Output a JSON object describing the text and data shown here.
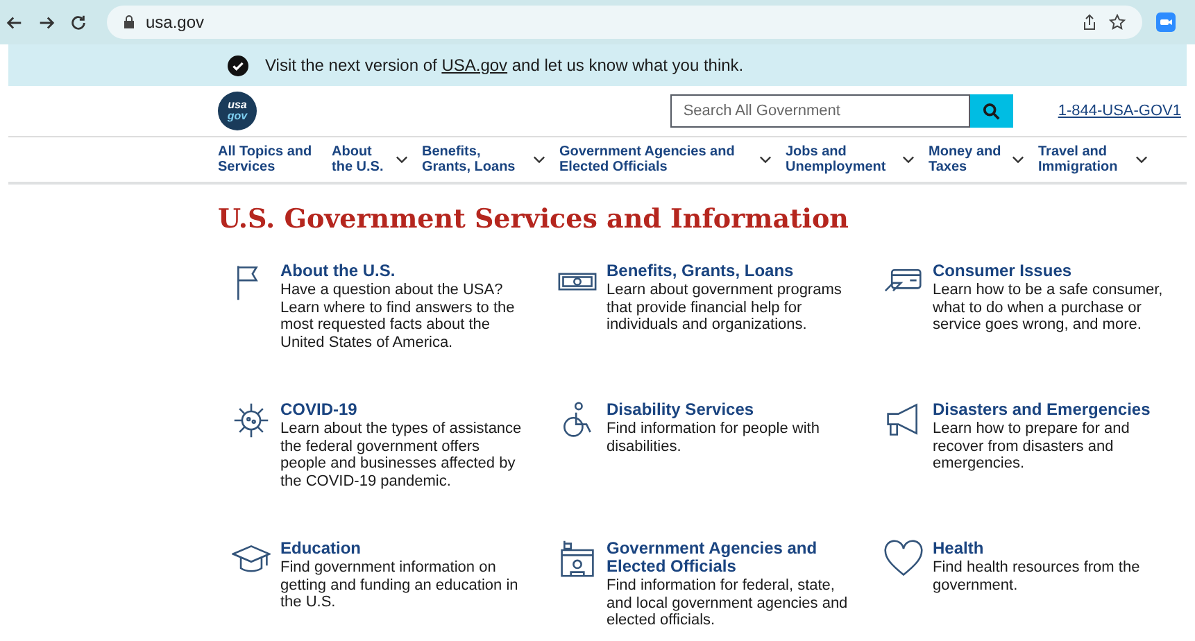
{
  "browser": {
    "url": "usa.gov"
  },
  "banner": {
    "before": "Visit the next version of ",
    "link": "USA.gov",
    "after": " and let us know what you think."
  },
  "logo": {
    "line1": "usa",
    "line2": "gov"
  },
  "search": {
    "placeholder": "Search All Government"
  },
  "phone": "1-844-USA-GOV1",
  "nav": [
    {
      "label": "All Topics and Services",
      "dropdown": false
    },
    {
      "label": "About the U.S.",
      "dropdown": true
    },
    {
      "label": "Benefits, Grants, Loans",
      "dropdown": true
    },
    {
      "label": "Government Agencies and Elected Officials",
      "dropdown": true
    },
    {
      "label": "Jobs and Unemployment",
      "dropdown": true
    },
    {
      "label": "Money and Taxes",
      "dropdown": true
    },
    {
      "label": "Travel and Immigration",
      "dropdown": true
    }
  ],
  "title": "U.S. Government Services and Information",
  "topics": [
    {
      "kind": "flag",
      "title": "About the U.S.",
      "text": "Have a question about the USA? Learn where to find answers to the most requested facts about the United States of America."
    },
    {
      "kind": "money",
      "title": "Benefits, Grants, Loans",
      "text": "Learn about government programs that provide financial help for individuals and organizations."
    },
    {
      "kind": "card",
      "title": "Consumer Issues",
      "text": "Learn how to be a safe consumer, what to do when a purchase or service goes wrong, and more."
    },
    {
      "kind": "virus",
      "title": "COVID-19",
      "text": "Learn about the types of assistance the federal government offers people and businesses affected by the COVID-19 pandemic."
    },
    {
      "kind": "wheelchair",
      "title": "Disability Services",
      "text": "Find information for people with disabilities."
    },
    {
      "kind": "megaphone",
      "title": "Disasters and Emergencies",
      "text": "Learn how to prepare for and recover from disasters and emergencies."
    },
    {
      "kind": "cap",
      "title": "Education",
      "text": "Find government information on getting and funding an education in the U.S."
    },
    {
      "kind": "building",
      "title": "Government Agencies and Elected Officials",
      "text": "Find information for federal, state, and local government agencies and elected officials."
    },
    {
      "kind": "heart",
      "title": "Health",
      "text": "Find health resources from the government."
    }
  ]
}
